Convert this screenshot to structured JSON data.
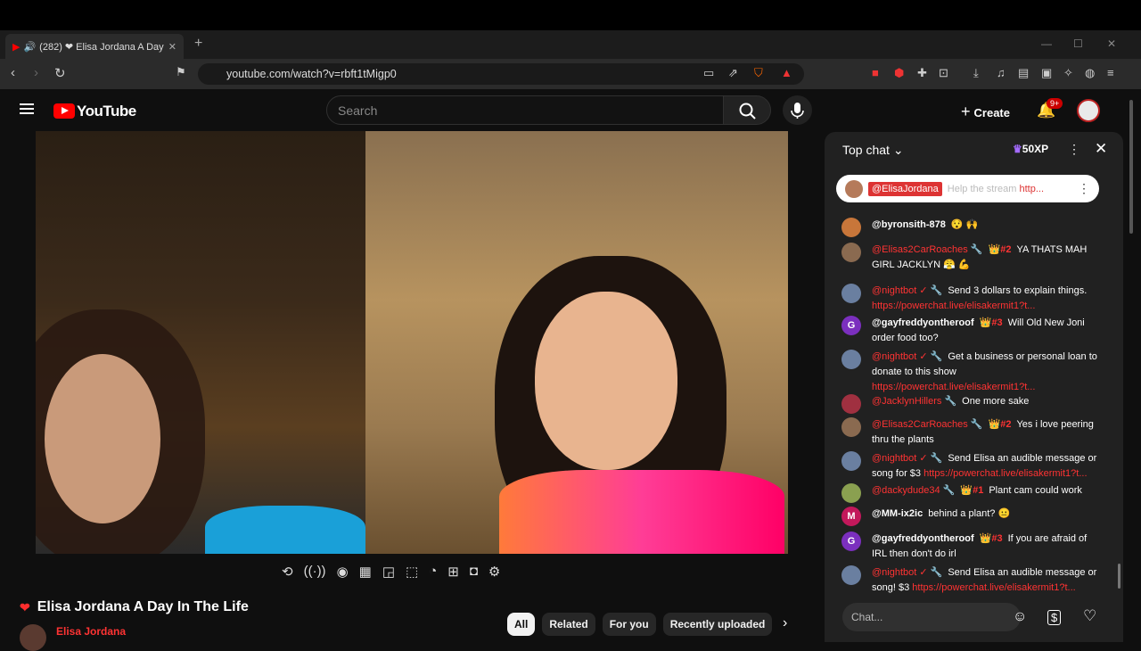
{
  "browser": {
    "tab_title": "(282) ❤ Elisa Jordana A Day",
    "tab_close": "✕",
    "new_tab": "+",
    "url": "youtube.com/watch?v=rbft1tMigp0",
    "win_min": "—",
    "win_max": "☐",
    "win_close": "✕"
  },
  "header": {
    "logo_text": "YouTube",
    "search_placeholder": "Search",
    "create_label": "Create",
    "notif_count": "9+"
  },
  "video": {
    "title": "Elisa Jordana A Day In The Life",
    "channel": "Elisa Jordana"
  },
  "chips": [
    "All",
    "Related",
    "For you",
    "Recently uploaded"
  ],
  "chat": {
    "mode": "Top chat",
    "xp": "50XP",
    "pinned": {
      "user": "@ElisaJordana",
      "message": "Help the stream",
      "link": "http..."
    },
    "messages": [
      {
        "avatar": "",
        "avatar_color": "#c8763a",
        "user": "@byronsith-878",
        "user_style": "white",
        "badge": "",
        "text": "😯 🙌",
        "link": ""
      },
      {
        "avatar": "",
        "avatar_color": "#8a6a50",
        "user": "@Elisas2CarRoaches 🔧",
        "user_style": "red",
        "badge": "👑#2",
        "text": "YA THATS MAH GIRL JACKLYN 😤 💪",
        "link": ""
      },
      {
        "avatar": "",
        "avatar_color": "#6a7fa0",
        "user": "@nightbot ✓ 🔧",
        "user_style": "red",
        "badge": "",
        "text": "Send 3 dollars to explain things.",
        "link": "https://powerchat.live/elisakermit1?t..."
      },
      {
        "avatar": "G",
        "avatar_color": "#7b2fbe",
        "user": "@gayfreddyontheroof",
        "user_style": "white",
        "badge": "👑#3",
        "text": "Will Old New Joni order food too?",
        "link": ""
      },
      {
        "avatar": "",
        "avatar_color": "#6a7fa0",
        "user": "@nightbot ✓ 🔧",
        "user_style": "red",
        "badge": "",
        "text": "Get a business or personal loan to donate to this show",
        "link": "https://powerchat.live/elisakermit1?t..."
      },
      {
        "avatar": "",
        "avatar_color": "#a03040",
        "user": "@JacklynHillers 🔧",
        "user_style": "red",
        "badge": "",
        "text": "One more sake",
        "link": ""
      },
      {
        "avatar": "",
        "avatar_color": "#8a6a50",
        "user": "@Elisas2CarRoaches 🔧",
        "user_style": "red",
        "badge": "👑#2",
        "text": "Yes i love peering thru the plants",
        "link": ""
      },
      {
        "avatar": "",
        "avatar_color": "#6a7fa0",
        "user": "@nightbot ✓ 🔧",
        "user_style": "red",
        "badge": "",
        "text": "Send Elisa an audible message or song for $3",
        "link": "https://powerchat.live/elisakermit1?t..."
      },
      {
        "avatar": "",
        "avatar_color": "#8aa050",
        "user": "@dackydude34 🔧",
        "user_style": "red",
        "badge": "👑#1",
        "text": "Plant cam could work",
        "link": ""
      },
      {
        "avatar": "M",
        "avatar_color": "#c2185b",
        "user": "@MM-ix2ic",
        "user_style": "white",
        "badge": "",
        "text": "behind a plant? 😐",
        "link": ""
      },
      {
        "avatar": "G",
        "avatar_color": "#7b2fbe",
        "user": "@gayfreddyontheroof",
        "user_style": "white",
        "badge": "👑#3",
        "text": "If you are afraid of IRL then don't do irl",
        "link": ""
      },
      {
        "avatar": "",
        "avatar_color": "#6a7fa0",
        "user": "@nightbot ✓ 🔧",
        "user_style": "red",
        "badge": "",
        "text": "Send Elisa an audible message or song! $3",
        "link": "https://powerchat.live/elisakermit1?t..."
      }
    ],
    "input_placeholder": "Chat..."
  }
}
